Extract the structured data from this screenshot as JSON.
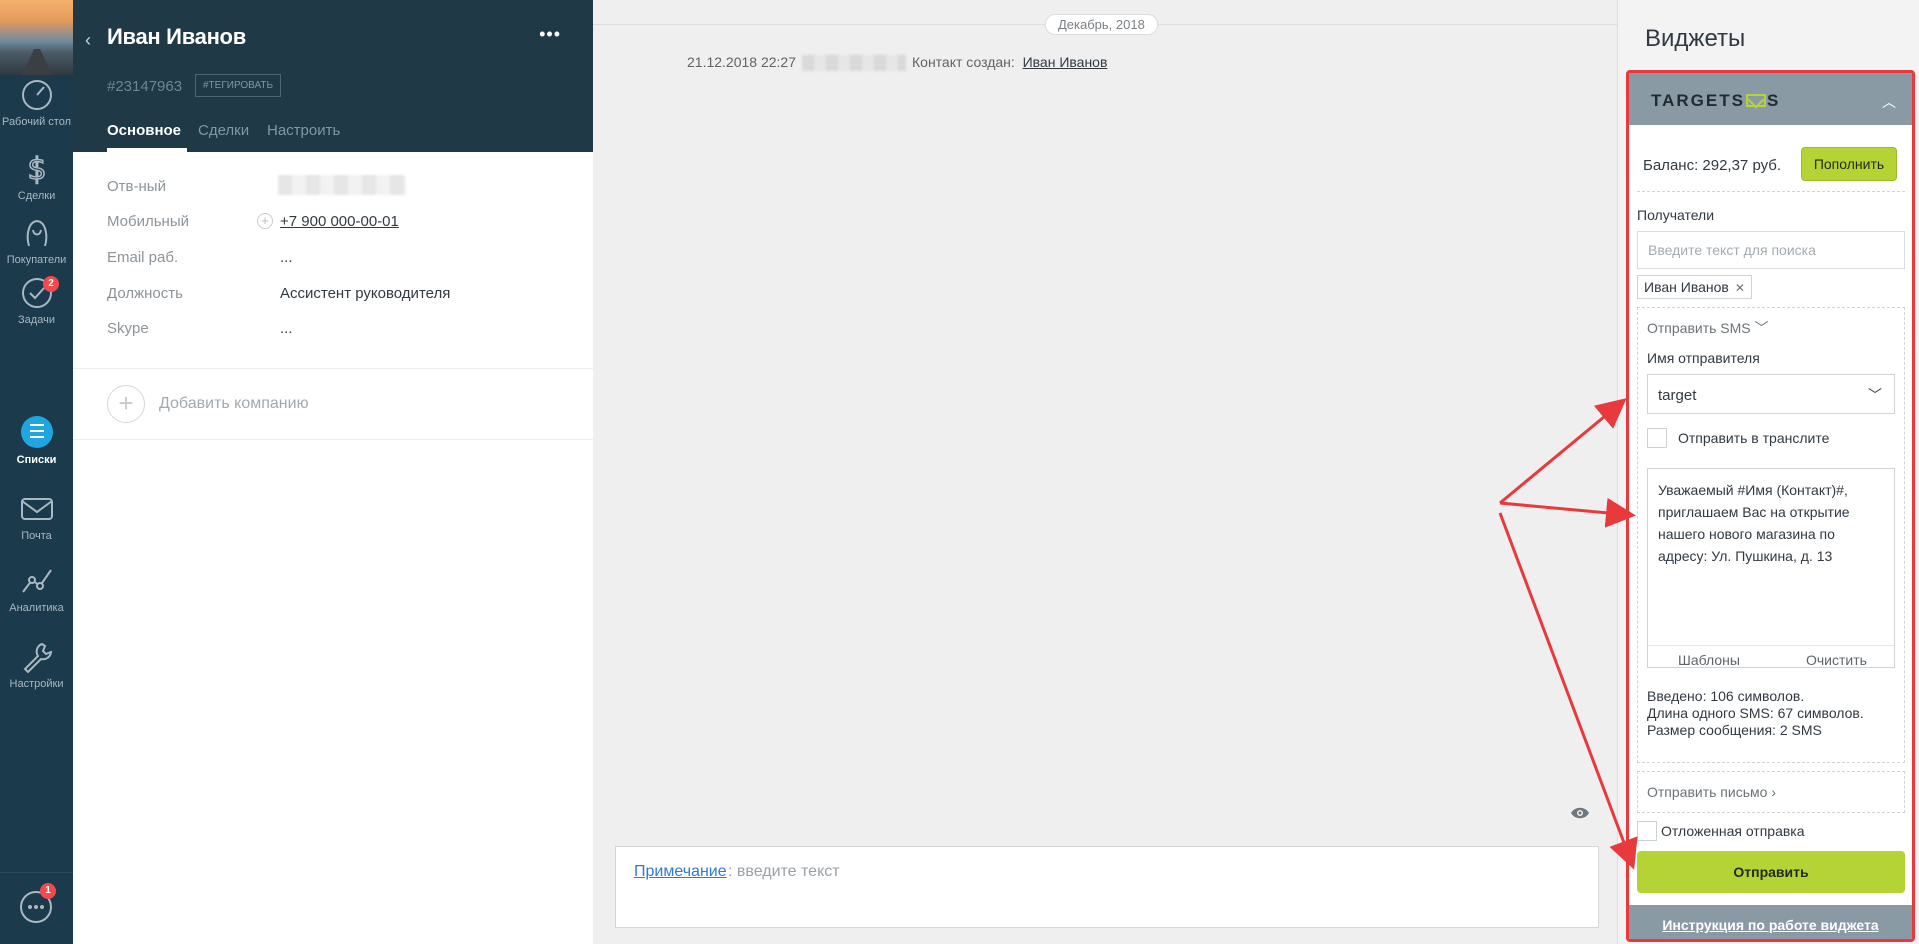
{
  "nav": {
    "items": [
      {
        "label": "Рабочий стол",
        "icon": "dashboard-icon"
      },
      {
        "label": "Сделки",
        "icon": "dollar-icon"
      },
      {
        "label": "Покупатели",
        "icon": "customers-icon"
      },
      {
        "label": "Задачи",
        "icon": "check-icon",
        "badge": "2"
      },
      {
        "label": "Списки",
        "icon": "lists-icon"
      },
      {
        "label": "Почта",
        "icon": "mail-icon"
      },
      {
        "label": "Аналитика",
        "icon": "analytics-icon"
      },
      {
        "label": "Настройки",
        "icon": "wrench-icon"
      }
    ],
    "chat_badge": "1"
  },
  "card": {
    "name": "Иван Иванов",
    "id": "#23147963",
    "tag_button": "#ТЕГИРОВАТЬ",
    "tabs": [
      "Основное",
      "Сделки",
      "Настроить"
    ],
    "fields": [
      {
        "label": "Отв-ный",
        "value": ""
      },
      {
        "label": "Мобильный",
        "value": "+7 900 000-00-01"
      },
      {
        "label": "Email раб.",
        "value": "..."
      },
      {
        "label": "Должность",
        "value": "Ассистент руководителя"
      },
      {
        "label": "Skype",
        "value": "..."
      }
    ],
    "add_company": "Добавить компанию"
  },
  "feed": {
    "date": "Декабрь, 2018",
    "event_time": "21.12.2018 22:27",
    "event_text": "Контакт создан:",
    "event_link": "Иван Иванов",
    "note_label": "Примечание",
    "note_placeholder": ": введите текст"
  },
  "widgets": {
    "title": "Виджеты",
    "logo_left": "TARGETS",
    "logo_right": "S",
    "balance": "Баланс: 292,37 руб.",
    "topup": "Пополнить",
    "recipients_label": "Получатели",
    "recipients_placeholder": "Введите текст для поиска",
    "recipient_chip": "Иван Иванов",
    "send_sms_toggle": "Отправить SMS",
    "sender_label": "Имя отправителя",
    "sender_value": "target",
    "translit_label": "Отправить в транслите",
    "message": "Уважаемый #Имя (Контакт)#, приглашаем Вас на открытие нашего нового магазина по адресу: Ул. Пушкина, д. 13",
    "templates": "Шаблоны",
    "clear": "Очистить",
    "stat_entered": "Введено: 106 символов.",
    "stat_length": "Длина одного SMS: 67 символов.",
    "stat_size": "Размер сообщения: 2 SMS",
    "send_email_toggle": "Отправить письмо",
    "delayed_label": "Отложенная отправка",
    "send_button": "Отправить",
    "instruction": "Инструкция по работе виджета",
    "accent_color": "#b5d335",
    "highlight_color": "#e8393d"
  }
}
